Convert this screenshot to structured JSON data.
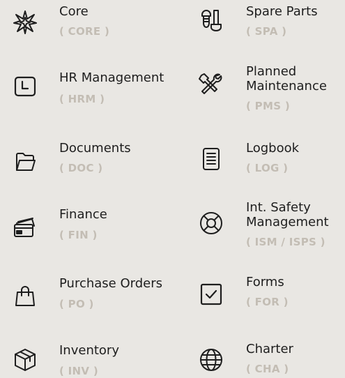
{
  "modules": [
    {
      "name": "Core",
      "code": "( CORE )",
      "icon": "star-compass-icon"
    },
    {
      "name": "Spare Parts",
      "code": "( SPA )",
      "icon": "bolts-icon"
    },
    {
      "name": "HR Management",
      "code": "( HRM )",
      "icon": "clock-icon"
    },
    {
      "name": "Planned\nMaintenance",
      "name_line1": "Planned",
      "name_line2": "Maintenance",
      "code": "( PMS )",
      "icon": "wrench-screwdriver-icon"
    },
    {
      "name": "Documents",
      "code": "( DOC )",
      "icon": "folder-icon"
    },
    {
      "name": "Logbook",
      "code": "( LOG )",
      "icon": "notebook-icon"
    },
    {
      "name": "Finance",
      "code": "( FIN )",
      "icon": "cards-icon"
    },
    {
      "name": "Int. Safety\nManagement",
      "name_line1": "Int. Safety",
      "name_line2": "Management",
      "code": "( ISM / ISPS )",
      "icon": "lifebuoy-icon"
    },
    {
      "name": "Purchase Orders",
      "code": "( PO )",
      "icon": "shopping-bag-icon"
    },
    {
      "name": "Forms",
      "code": "( FOR )",
      "icon": "checkbox-icon"
    },
    {
      "name": "Inventory",
      "code": "( INV )",
      "icon": "box-icon"
    },
    {
      "name": "Charter",
      "code": "( CHA )",
      "icon": "globe-icon"
    }
  ],
  "colors": {
    "background": "#e9e7e3",
    "text": "#1e1e1e",
    "code": "#c3bdb4"
  }
}
